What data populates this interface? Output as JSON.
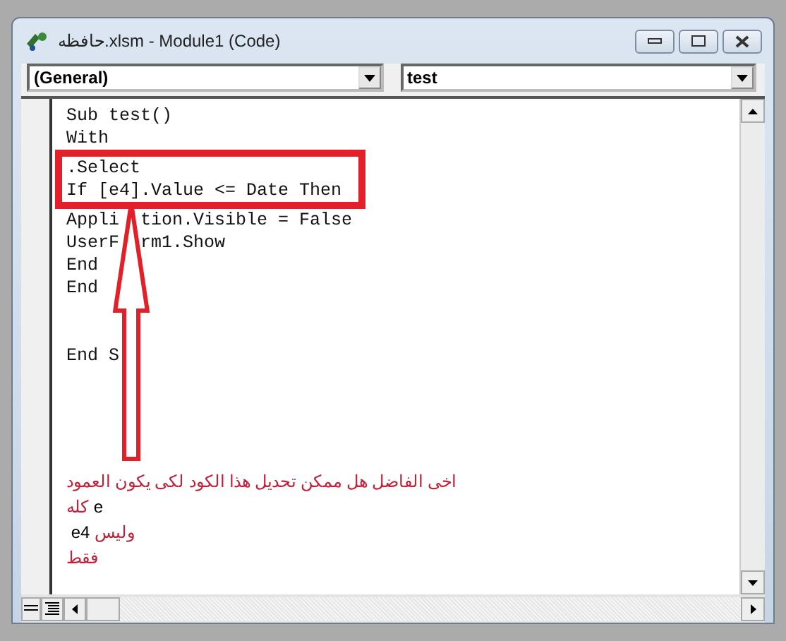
{
  "window": {
    "title": "حافظه.xlsm - Module1 (Code)"
  },
  "object_dropdown": {
    "value": "(General)"
  },
  "procedure_dropdown": {
    "value": "test"
  },
  "code": {
    "before": [
      {
        "text": "Sub test()"
      },
      {
        "text": "With"
      }
    ],
    "highlighted": [
      {
        "text": ".Select"
      },
      {
        "text": "If [e4].Value <= Date Then"
      }
    ],
    "after": [
      {
        "text": "Appli",
        "rest": "tion.Visible = False"
      },
      {
        "text": "UserF",
        "rest": "rm1.Show"
      },
      {
        "text": "End"
      },
      {
        "text": "End"
      }
    ],
    "end": [
      {
        "text": "End S"
      }
    ]
  },
  "note": [
    [
      {
        "text": "اخى الفاضل هل ممكن تحديل هذا الكود لكى يكون العمود",
        "color": "#c0203a"
      }
    ],
    [
      {
        "text": "كله",
        "color": "#c0203a"
      },
      {
        "text": " e",
        "color": "#000000"
      }
    ],
    [
      {
        "text": " e4",
        "color": "#000000"
      },
      {
        "text": " وليس",
        "color": "#c0203a"
      }
    ],
    [
      {
        "text": "فقط",
        "color": "#c0203a"
      }
    ]
  ]
}
